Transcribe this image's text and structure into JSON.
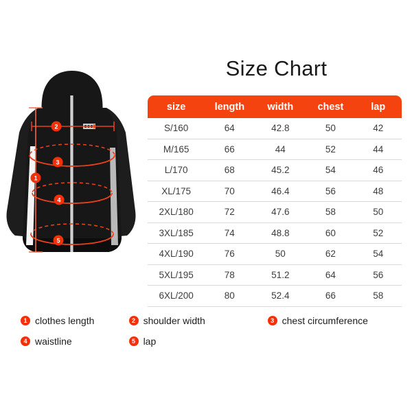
{
  "title": "Size Chart",
  "colors": {
    "accent": "#f4430f",
    "marker": "#f4300b",
    "garment": "#171717",
    "garment_dark": "#0d0d0d",
    "row_border": "#d8d8d8",
    "background": "#ffffff"
  },
  "table": {
    "headers": [
      "size",
      "length",
      "width",
      "chest",
      "lap"
    ],
    "rows": [
      [
        "S/160",
        "64",
        "42.8",
        "50",
        "42"
      ],
      [
        "M/165",
        "66",
        "44",
        "52",
        "44"
      ],
      [
        "L/170",
        "68",
        "45.2",
        "54",
        "46"
      ],
      [
        "XL/175",
        "70",
        "46.4",
        "56",
        "48"
      ],
      [
        "2XL/180",
        "72",
        "47.6",
        "58",
        "50"
      ],
      [
        "3XL/185",
        "74",
        "48.8",
        "60",
        "52"
      ],
      [
        "4XL/190",
        "76",
        "50",
        "62",
        "54"
      ],
      [
        "5XL/195",
        "78",
        "51.2",
        "64",
        "56"
      ],
      [
        "6XL/200",
        "80",
        "52.4",
        "66",
        "58"
      ]
    ]
  },
  "legend": {
    "items": [
      {
        "number": "1",
        "label": "clothes length"
      },
      {
        "number": "2",
        "label": "shoulder width"
      },
      {
        "number": "3",
        "label": "chest circumference"
      },
      {
        "number": "4",
        "label": "waistline"
      },
      {
        "number": "5",
        "label": "lap"
      }
    ]
  },
  "figure": {
    "alt": "hooded jacket back view with measurement guides",
    "markers": [
      {
        "number": "1",
        "measurement": "clothes length"
      },
      {
        "number": "2",
        "measurement": "shoulder width"
      },
      {
        "number": "3",
        "measurement": "chest circumference"
      },
      {
        "number": "4",
        "measurement": "waistline"
      },
      {
        "number": "5",
        "measurement": "lap"
      }
    ]
  }
}
